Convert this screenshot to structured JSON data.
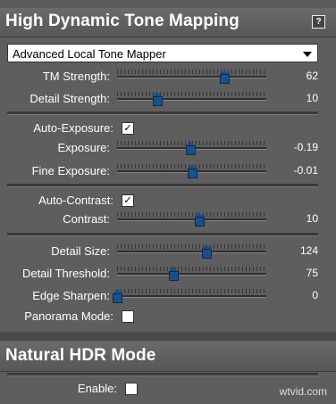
{
  "panel1": {
    "title": "High Dynamic Tone Mapping",
    "help": "?",
    "mode_select": "Advanced Local Tone Mapper",
    "sliders": [
      {
        "label": "TM Strength:",
        "value": "62",
        "level": 0.72
      },
      {
        "label": "Detail Strength:",
        "value": "10",
        "level": 0.27
      },
      {
        "label": "Exposure:",
        "value": "-0.19",
        "level": 0.49
      },
      {
        "label": "Fine Exposure:",
        "value": "-0.01",
        "level": 0.5
      },
      {
        "label": "Contrast:",
        "value": "10",
        "level": 0.55
      },
      {
        "label": "Detail Size:",
        "value": "124",
        "level": 0.6
      },
      {
        "label": "Detail Threshold:",
        "value": "75",
        "level": 0.38
      },
      {
        "label": "Edge Sharpen:",
        "value": "0",
        "level": 0.0
      }
    ],
    "auto_exposure": {
      "label": "Auto-Exposure:",
      "checked": true,
      "mark": "✓"
    },
    "auto_contrast": {
      "label": "Auto-Contrast:",
      "checked": true,
      "mark": "✓"
    },
    "panorama_mode": {
      "label": "Panorama Mode:",
      "checked": false,
      "mark": ""
    }
  },
  "panel2": {
    "title": "Natural HDR Mode",
    "enable": {
      "label": "Enable:",
      "checked": false,
      "mark": ""
    }
  },
  "watermark": "wtvid.com",
  "colors": {
    "thumb": "#1a4f8a",
    "panel": "#5e5e5e",
    "header": "#5f5f5f"
  }
}
